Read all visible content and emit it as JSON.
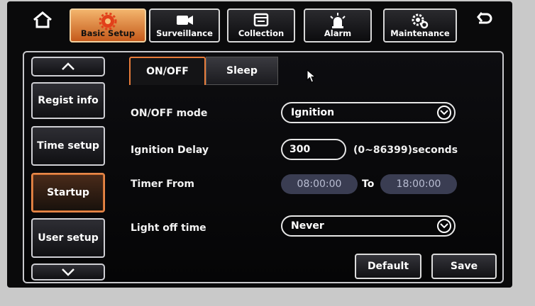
{
  "toolbar": {
    "home_icon": "home-icon",
    "back_icon": "back-arrow-icon",
    "tabs": [
      {
        "label": "Basic Setup",
        "icon": "gear-icon",
        "active": true
      },
      {
        "label": "Surveillance",
        "icon": "camera-icon",
        "active": false
      },
      {
        "label": "Collection",
        "icon": "collection-icon",
        "active": false
      },
      {
        "label": "Alarm",
        "icon": "alarm-icon",
        "active": false
      },
      {
        "label": "Maintenance",
        "icon": "maintenance-icon",
        "active": false
      }
    ]
  },
  "sidebar": {
    "up_icon": "chevron-up-icon",
    "down_icon": "chevron-down-icon",
    "items": [
      {
        "label": "Regist info",
        "active": false
      },
      {
        "label": "Time setup",
        "active": false
      },
      {
        "label": "Startup",
        "active": true
      },
      {
        "label": "User setup",
        "active": false
      }
    ]
  },
  "subtabs": [
    {
      "label": "ON/OFF",
      "active": true
    },
    {
      "label": "Sleep",
      "active": false
    }
  ],
  "form": {
    "onoff_mode": {
      "label": "ON/OFF mode",
      "value": "Ignition"
    },
    "ignition_delay": {
      "label": "Ignition Delay",
      "value": "300",
      "unit": "(0~86399)seconds"
    },
    "timer": {
      "label": "Timer From",
      "from": "08:00:00",
      "to_label": "To",
      "to": "18:00:00"
    },
    "light_off": {
      "label": "Light off time",
      "value": "Never"
    }
  },
  "actions": {
    "default_label": "Default",
    "save_label": "Save"
  },
  "colors": {
    "accent": "#e77b3a",
    "active_tab": "#f3b46c",
    "time_field": "#3a3d52"
  }
}
